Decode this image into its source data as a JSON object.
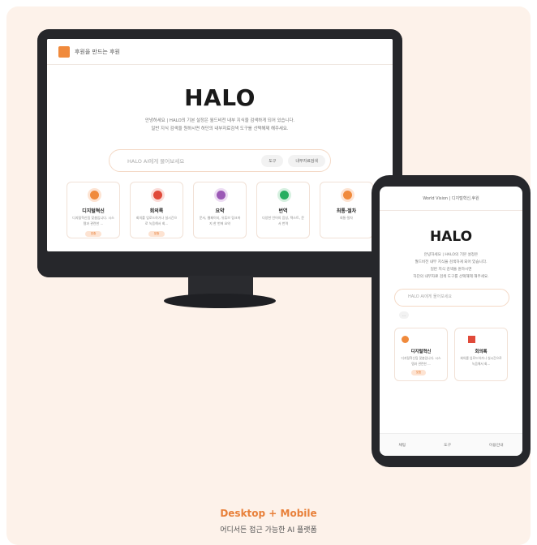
{
  "desktop": {
    "brand": "후원을 만드는 후원",
    "title": "HALO",
    "desc_line1": "안녕하세요 | HALO의 기본 설정은 월드비전 내부 지식을 검색하게 되어 있습니다.",
    "desc_line2": "일반 지식 검색을 원하시면 하단의 내부자료검색 도구를 선택해제 해주세요.",
    "search_placeholder": "HALO AI에게 물어보세요",
    "tool_pill": "도구",
    "internal_pill": "내부자료검색",
    "cards": [
      {
        "title": "디지털혁신",
        "desc": "디지털혁신팀 맞춤입니다. 시스템과 관련한 ...",
        "badge": "맞춤",
        "color": "#f08a3c"
      },
      {
        "title": "회의록",
        "desc": "회의를 업로드하거나 실시간으로 녹음해서 회...",
        "badge": "맞춤",
        "color": "#e04a3a"
      },
      {
        "title": "요약",
        "desc": "문서, 웹페이지, 유튜브 링크까지 한 번에 요약",
        "badge": "",
        "color": "#9b59b6"
      },
      {
        "title": "번역",
        "desc": "다양한 언어의 음성, 텍스트, 문서 번역",
        "badge": "",
        "color": "#27ae60"
      },
      {
        "title": "최통·절차",
        "desc": "회통·절차",
        "badge": "",
        "color": "#f08a3c"
      }
    ]
  },
  "mobile": {
    "header": "World Vision | 디지털혁신,후원",
    "title": "HALO",
    "desc_line1": "안녕하세요 | HALO의 기본 설정은",
    "desc_line2": "월드비전 내부 지식을 검색하게 되어 있습니다.",
    "desc_line3": "일반 지식 검색을 원하시면",
    "desc_line4": "하단의 내부자료 검색 도구를 선택해제 해주세요.",
    "search_placeholder": "HALO AI에게 물어보세요",
    "pill": "...",
    "cards": [
      {
        "title": "디지털혁신",
        "desc": "디지털혁신팀 맞춤입니다. 시스템과 관련한 ...",
        "badge": "맞춤"
      },
      {
        "title": "회의록",
        "desc": "회의를 업로드하거나 실시간으로 녹음해서 회...",
        "badge": ""
      }
    ],
    "nav": [
      "채팅",
      "도구",
      "이용안내"
    ]
  },
  "footer": {
    "title": "Desktop + Mobile",
    "subtitle": "어디서든 접근 가능한 AI 플랫폼"
  }
}
